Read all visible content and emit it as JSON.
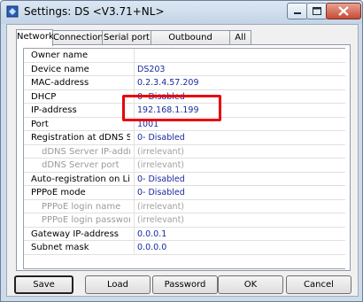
{
  "window": {
    "title": "Settings: DS <V3.71+NL>"
  },
  "tabs": [
    "Network",
    "Connection",
    "Serial port",
    "Outbound packets",
    "All"
  ],
  "rows": [
    {
      "label": "Owner name",
      "value": "",
      "sub": false
    },
    {
      "label": "Device name",
      "value": "DS203",
      "sub": false
    },
    {
      "label": "MAC-address",
      "value": "0.2.3.4.57.209",
      "sub": false
    },
    {
      "label": "DHCP",
      "value": "0- Disabled",
      "sub": false
    },
    {
      "label": "IP-address",
      "value": "192.168.1.199",
      "sub": false
    },
    {
      "label": "Port",
      "value": "1001",
      "sub": false
    },
    {
      "label": "Registration at dDNS Serve",
      "value": "0- Disabled",
      "sub": false
    },
    {
      "label": "dDNS Server IP-address",
      "value": "(irrelevant)",
      "sub": true
    },
    {
      "label": "dDNS Server port",
      "value": "(irrelevant)",
      "sub": true
    },
    {
      "label": "Auto-registration on Link S",
      "value": "0- Disabled",
      "sub": false
    },
    {
      "label": "PPPoE mode",
      "value": "0- Disabled",
      "sub": false
    },
    {
      "label": "PPPoE login name",
      "value": "(irrelevant)",
      "sub": true
    },
    {
      "label": "PPPoE login password",
      "value": "(irrelevant)",
      "sub": true
    },
    {
      "label": "Gateway IP-address",
      "value": "0.0.0.1",
      "sub": false
    },
    {
      "label": "Subnet mask",
      "value": "0.0.0.0",
      "sub": false
    }
  ],
  "buttons": {
    "save": "Save",
    "load": "Load",
    "password": "Password",
    "ok": "OK",
    "cancel": "Cancel"
  },
  "colors": {
    "value_text": "#1a2a9c",
    "highlight": "#e8000b",
    "irrelevant_text": "#a0a0a0"
  }
}
